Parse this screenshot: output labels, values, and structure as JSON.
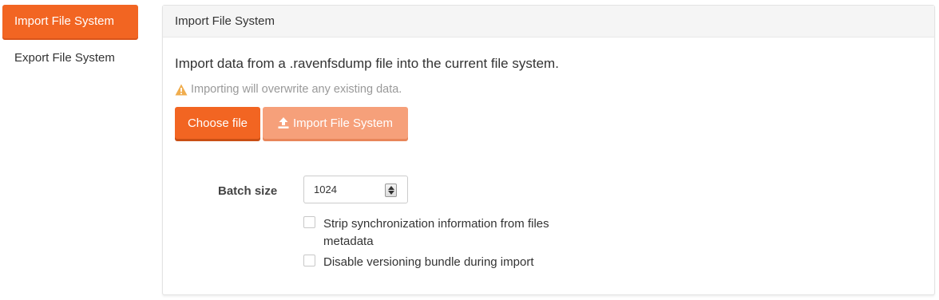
{
  "sidebar": {
    "items": [
      {
        "label": "Import File System",
        "active": true
      },
      {
        "label": "Export File System",
        "active": false
      }
    ]
  },
  "panel": {
    "heading": "Import File System",
    "intro": "Import data from a .ravenfsdump file into the current file system.",
    "warning": "Importing will overwrite any existing data.",
    "choose_button": "Choose file",
    "import_button": "Import File System",
    "batch_label": "Batch size",
    "batch_value": "1024",
    "checkbox_strip": "Strip synchronization information from files metadata",
    "checkbox_versioning": "Disable versioning bundle during import"
  },
  "colors": {
    "accent": "#f26522",
    "accent_disabled": "#f6a07a",
    "warning_icon": "#f0ad4e"
  }
}
